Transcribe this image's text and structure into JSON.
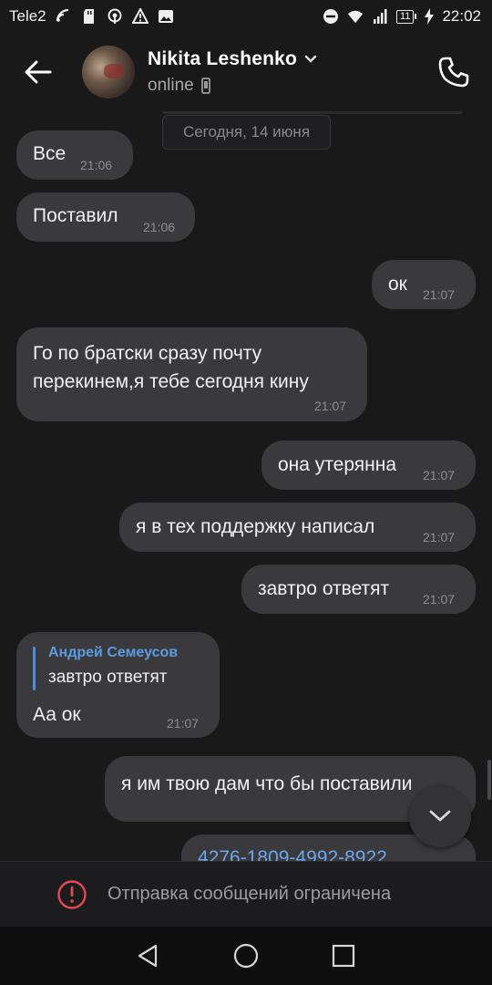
{
  "status_bar": {
    "carrier": "Tele2",
    "battery": "11",
    "time": "22:02",
    "icons": [
      "wifi-icon",
      "sd-card-icon",
      "hotspot-icon",
      "warning-icon",
      "image-icon",
      "do-not-disturb-icon",
      "wifi-icon",
      "signal-icon",
      "battery-icon",
      "charging-icon"
    ]
  },
  "header": {
    "name": "Nikita Leshenko",
    "status": "online",
    "icons": [
      "back-arrow-icon",
      "chevron-down-icon",
      "phone-device-icon",
      "phone-call-icon"
    ]
  },
  "chat": {
    "date_chip": "Сегодня, 14 июня",
    "messages": [
      {
        "side": "in",
        "text": "Все",
        "time": "21:06"
      },
      {
        "side": "in",
        "text": "Поставил",
        "time": "21:06"
      },
      {
        "side": "out",
        "text": "ок",
        "time": "21:07"
      },
      {
        "side": "in",
        "text_line1": "Го по братски сразу почту",
        "text_line2": "перекинем,я тебе сегодня кину",
        "time": "21:07"
      },
      {
        "side": "out",
        "text": "она утерянна",
        "time": "21:07"
      },
      {
        "side": "out",
        "text": "я в тех поддержку написал",
        "time": "21:07"
      },
      {
        "side": "out",
        "text": "завтро ответят",
        "time": "21:07"
      },
      {
        "side": "in",
        "reply_author": "Андрей Семеусов",
        "reply_text": "завтро ответят",
        "text": "Аа ок",
        "time": "21:07"
      },
      {
        "side": "out",
        "text": "я им твою дам что бы поставили"
      },
      {
        "side": "out",
        "text": "4276-1809-4992-8922"
      }
    ]
  },
  "footer": {
    "restricted_text": "Отправка сообщений ограничена",
    "icons": [
      "error-icon"
    ]
  },
  "nav": {
    "icons": [
      "back-triangle-icon",
      "home-circle-icon",
      "recents-square-icon"
    ]
  },
  "colors": {
    "background": "#19191a",
    "bubble": "#3a3a3c",
    "link": "#6aa7ec",
    "reply_accent": "#4d8fd6",
    "error": "#e5484d"
  }
}
